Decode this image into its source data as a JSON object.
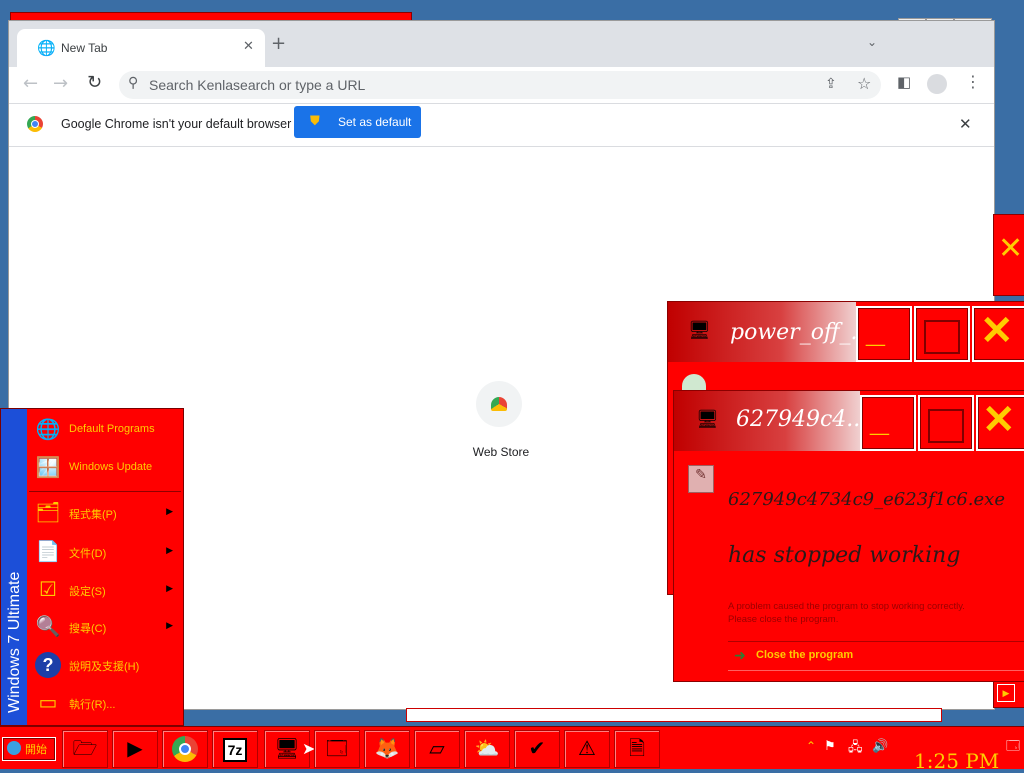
{
  "chrome": {
    "tab_title": "New Tab",
    "omnibox_placeholder": "Search Kenlasearch or type a URL",
    "infobar_text": "Google Chrome isn't your default browser",
    "set_default_label": "Set as default",
    "shortcut_label": "Web Store"
  },
  "power_window": {
    "title": "power_off_...",
    "minimize_glyph": "_",
    "close_glyph": "✕"
  },
  "error_window": {
    "title": "627949c4...",
    "exe_name": "627949c4734c9_e623f1c6.exe",
    "stopped_text": "has stopped working",
    "detail_line1": "A problem caused the program to stop working correctly.",
    "detail_line2": "Please close the program.",
    "close_program_label": "Close the program",
    "minimize_glyph": "_",
    "close_glyph": "✕"
  },
  "start_menu": {
    "side_label": "Windows 7 Ultimate",
    "items": [
      {
        "label": "Default Programs",
        "icon": "default-programs-icon",
        "arrow": false
      },
      {
        "label": "Windows Update",
        "icon": "windows-update-icon",
        "arrow": false
      },
      {
        "label": "程式集(P)",
        "icon": "programs-icon",
        "arrow": true
      },
      {
        "label": "文件(D)",
        "icon": "documents-icon",
        "arrow": true
      },
      {
        "label": "設定(S)",
        "icon": "settings-icon",
        "arrow": true
      },
      {
        "label": "搜尋(C)",
        "icon": "search-icon",
        "arrow": true
      },
      {
        "label": "說明及支援(H)",
        "icon": "help-icon",
        "arrow": false
      },
      {
        "label": "執行(R)...",
        "icon": "run-icon",
        "arrow": false
      }
    ]
  },
  "taskbar": {
    "start_label": "開始",
    "clock": "1:25 PM",
    "sevenzip_label": "7z"
  },
  "colors": {
    "accent_red": "#ff0000",
    "chrome_blue": "#1a73e8",
    "start_blue": "#1c4fd8"
  }
}
